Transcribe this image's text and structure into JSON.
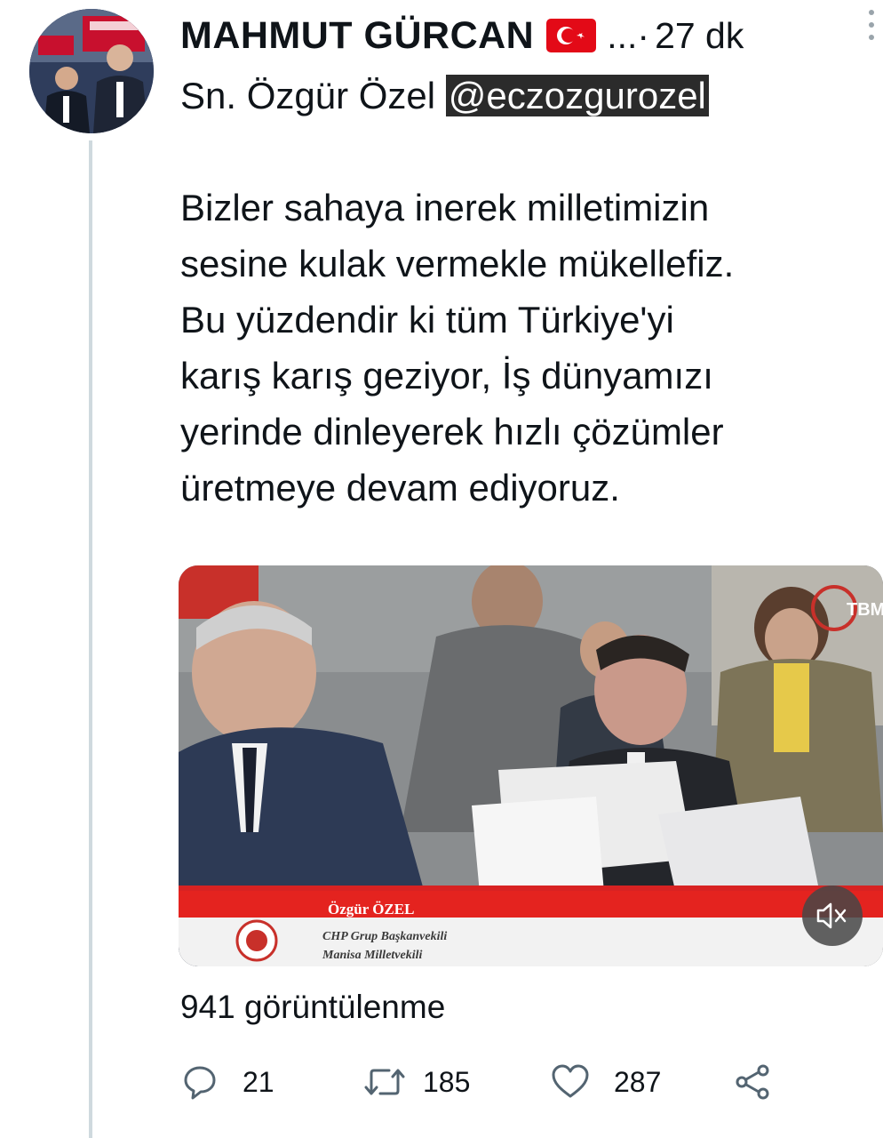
{
  "tweet": {
    "author": {
      "display_name": "MAHMUT GÜRCAN",
      "flag_icon": "turkey-flag-icon",
      "overflow": "...·",
      "time": "27 dk"
    },
    "text_before_mention": "Sn. Özgür Özel ",
    "mention": "@eczozgurozel",
    "text_after_mention": "\n\nBizler sahaya inerek milletimizin\nsesine kulak vermekle mükellefiz.\nBu yüzdendir ki tüm Türkiye'yi\nkarış karış geziyor, İş dünyamızı\nyerinde dinleyerek hızlı çözümler\nüretmeye devam ediyoruz.",
    "media": {
      "lower_third_name": "Özgür ÖZEL",
      "lower_third_title": "CHP Grup Başkanvekili",
      "lower_third_subtitle": "Manisa Milletvekili",
      "channel_logo": "TBMM",
      "mute_icon": "speaker-muted-icon"
    },
    "views": "941 görüntülenme",
    "actions": {
      "reply_count": "21",
      "retweet_count": "185",
      "like_count": "287"
    }
  },
  "colors": {
    "text": "#0f1419",
    "thread_line": "#cfd9de",
    "icon_gray": "#536471",
    "flag_red": "#e30a17"
  }
}
